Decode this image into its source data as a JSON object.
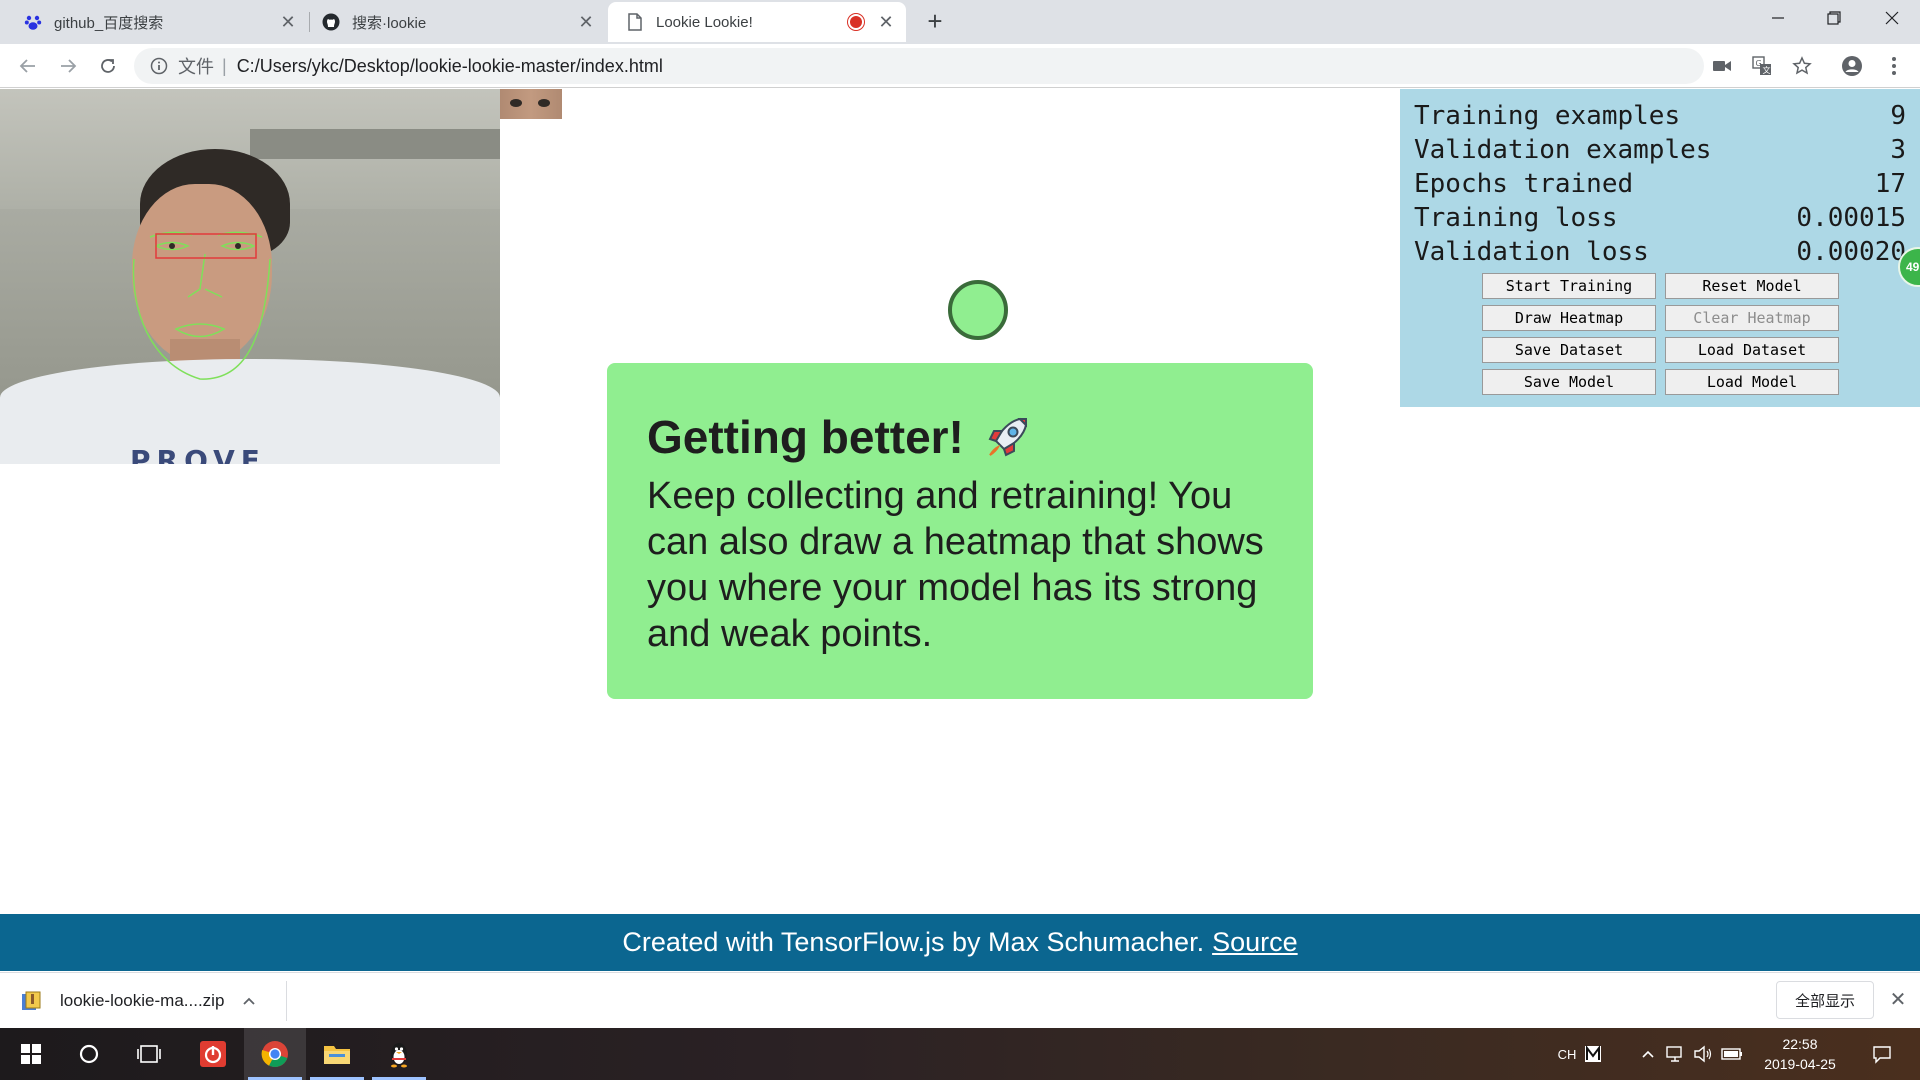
{
  "browser": {
    "tabs": [
      {
        "title": "github_百度搜索",
        "icon": "baidu-paw-icon",
        "active": false
      },
      {
        "title": "搜索·lookie",
        "icon": "github-icon",
        "active": false
      },
      {
        "title": "Lookie Lookie!",
        "icon": "page-icon",
        "active": true,
        "recording": true
      }
    ],
    "address": {
      "scheme_label": "文件",
      "url": "C:/Users/ykc/Desktop/lookie-lookie-master/index.html"
    }
  },
  "webcam": {
    "shirt_text": "PROVE"
  },
  "card": {
    "title": "Getting better!",
    "body": "Keep collecting and retraining! You can also draw a heatmap that shows you where your model has its strong and weak points."
  },
  "stats": {
    "rows": [
      {
        "label": "Training examples",
        "value": "9"
      },
      {
        "label": "Validation examples",
        "value": "3"
      },
      {
        "label": "Epochs trained",
        "value": "17"
      },
      {
        "label": "Training loss",
        "value": "0.00015"
      },
      {
        "label": "Validation loss",
        "value": "0.00020"
      }
    ],
    "buttons": [
      {
        "label": "Start Training",
        "disabled": false
      },
      {
        "label": "Reset Model",
        "disabled": false
      },
      {
        "label": "Draw Heatmap",
        "disabled": false
      },
      {
        "label": "Clear Heatmap",
        "disabled": true
      },
      {
        "label": "Save Dataset",
        "disabled": false
      },
      {
        "label": "Load Dataset",
        "disabled": false
      },
      {
        "label": "Save Model",
        "disabled": false
      },
      {
        "label": "Load Model",
        "disabled": false
      }
    ],
    "badge": "49"
  },
  "footer": {
    "text": "Created with TensorFlow.js by Max Schumacher.",
    "link": "Source"
  },
  "downloads": {
    "file": "lookie-lookie-ma....zip",
    "show_all": "全部显示"
  },
  "taskbar": {
    "ime": "CH",
    "clock_time": "22:58",
    "clock_date": "2019-04-25"
  },
  "colors": {
    "card_bg": "#90ee90",
    "stats_bg": "#add8e6",
    "footer_bg": "#0b6690",
    "target_fill": "#90ee90",
    "face_mesh": "#7fe05a",
    "eye_box": "#e23b3b"
  }
}
